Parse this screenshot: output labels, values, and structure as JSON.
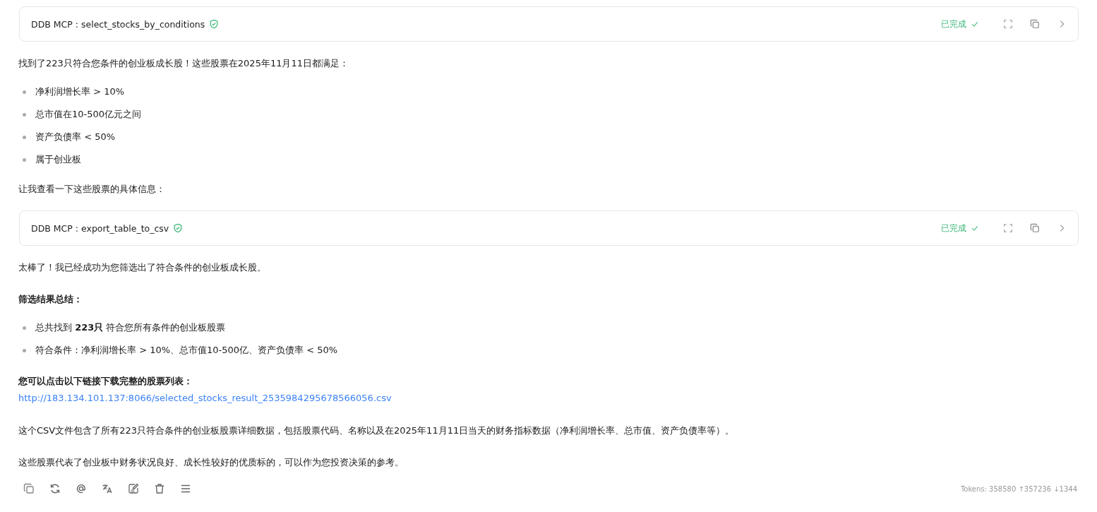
{
  "blocks": [
    {
      "kind": "tool",
      "label": "DDB MCP : select_stocks_by_conditions",
      "status": "已完成",
      "done": true
    },
    {
      "kind": "paragraph",
      "text": "找到了223只符合您条件的创业板成长股！这些股票在2025年11月11日都满足："
    },
    {
      "kind": "list",
      "items": [
        "净利润增长率 > 10%",
        "总市值在10-500亿元之间",
        "资产负债率 < 50%",
        "属于创业板"
      ]
    },
    {
      "kind": "paragraph",
      "text": "让我查看一下这些股票的具体信息："
    },
    {
      "kind": "tool",
      "label": "DDB MCP : export_table_to_csv",
      "status": "已完成",
      "done": true
    },
    {
      "kind": "paragraph",
      "text": "太棒了！我已经成功为您筛选出了符合条件的创业板成长股。"
    },
    {
      "kind": "heading",
      "text": "筛选结果总结："
    },
    {
      "kind": "list",
      "items": [
        "总共找到 **223只** 符合您所有条件的创业板股票",
        "符合条件：净利润增长率 > 10%、总市值10-500亿、资产负债率 < 50%"
      ]
    },
    {
      "kind": "link_block",
      "title": "您可以点击以下链接下载完整的股票列表：",
      "url": "http://183.134.101.137:8066/selected_stocks_result_2535984295678566056.csv"
    },
    {
      "kind": "paragraph",
      "text": "这个CSV文件包含了所有223只符合条件的创业板股票详细数据，包括股票代码、名称以及在2025年11月11日当天的财务指标数据（净利润增长率、总市值、资产负债率等）。"
    },
    {
      "kind": "paragraph",
      "text": "这些股票代表了创业板中财务状况良好、成长性较好的优质标的，可以作为您投资决策的参考。"
    }
  ],
  "toolbar": {
    "tokens": "Tokens: 358580 ↑357236 ↓1344"
  }
}
